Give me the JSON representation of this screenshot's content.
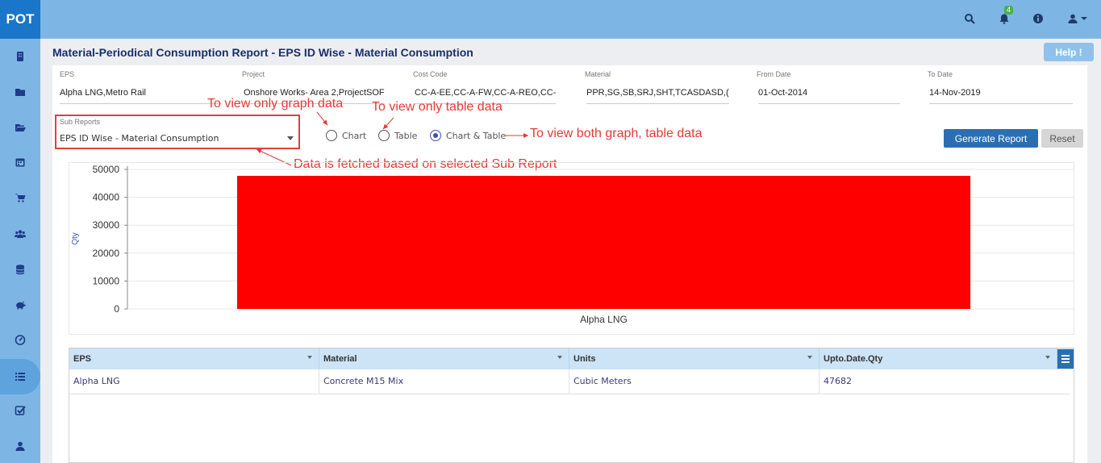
{
  "app": {
    "logo": "POT"
  },
  "sidebar": {
    "items": [
      {
        "icon": "building-icon"
      },
      {
        "icon": "folder-icon"
      },
      {
        "icon": "folder-open-icon"
      },
      {
        "icon": "calendar-icon"
      },
      {
        "icon": "cart-icon"
      },
      {
        "icon": "users-icon"
      },
      {
        "icon": "database-icon"
      },
      {
        "icon": "piggy-bank-icon"
      },
      {
        "icon": "dashboard-icon"
      },
      {
        "icon": "list-icon",
        "active": true
      },
      {
        "icon": "checkbox-icon"
      },
      {
        "icon": "user-icon"
      }
    ]
  },
  "topbar": {
    "notification_count": "4"
  },
  "page": {
    "title": "Material-Periodical Consumption Report - EPS ID Wise - Material Consumption",
    "help_label": "Help !"
  },
  "filters": {
    "eps": {
      "label": "EPS",
      "value": "Alpha LNG,Metro Rail"
    },
    "project": {
      "label": "Project",
      "value": "Onshore  Works- Area 2,ProjectSOF"
    },
    "cost_code": {
      "label": "Cost Code",
      "value": "CC-A-EE,CC-A-FW,CC-A-REO,CC-"
    },
    "material": {
      "label": "Material",
      "value": "PPR,SG,SB,SRJ,SHT,TCASDASD,("
    },
    "from_date": {
      "label": "From Date",
      "value": "01-Oct-2014"
    },
    "to_date": {
      "label": "To Date",
      "value": "14-Nov-2019"
    }
  },
  "sub_reports": {
    "label": "Sub Reports",
    "value": "EPS ID Wise - Material Consumption"
  },
  "view_options": [
    {
      "label": "Chart",
      "selected": false
    },
    {
      "label": "Table",
      "selected": false
    },
    {
      "label": "Chart & Table",
      "selected": true
    }
  ],
  "buttons": {
    "generate": "Generate Report",
    "reset": "Reset"
  },
  "annotations": {
    "graph": "To view only graph data",
    "table": "To view only table data",
    "both": "To view both graph, table data",
    "subreport": "Data is fetched based on selected Sub Report"
  },
  "colors": {
    "bar": "#ff0000",
    "accent": "#2a6fb1",
    "annotation": "#e53935"
  },
  "chart_data": {
    "type": "bar",
    "categories": [
      "Alpha LNG"
    ],
    "values": [
      47682
    ],
    "ylabel": "Qty",
    "ylim": [
      0,
      50000
    ],
    "yticks": [
      "0",
      "10000",
      "20000",
      "30000",
      "40000",
      "50000"
    ],
    "grid": true
  },
  "table": {
    "columns": [
      "EPS",
      "Material",
      "Units",
      "Upto.Date.Qty"
    ],
    "rows": [
      [
        "Alpha LNG",
        "Concrete M15 Mix",
        "Cubic Meters",
        "47682"
      ]
    ]
  }
}
